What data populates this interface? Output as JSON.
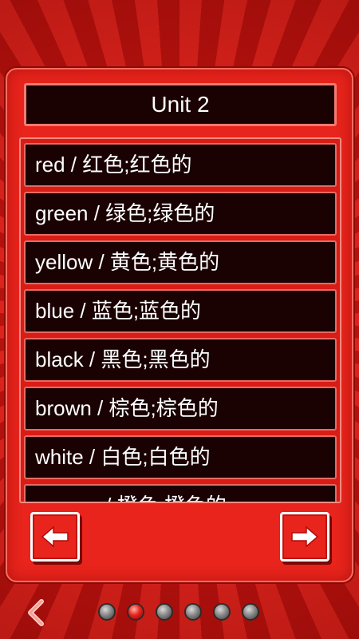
{
  "header": {
    "title": "Unit 2"
  },
  "vocabulary": {
    "items": [
      {
        "label": "red / 红色;红色的"
      },
      {
        "label": "green / 绿色;绿色的"
      },
      {
        "label": "yellow / 黄色;黄色的"
      },
      {
        "label": "blue / 蓝色;蓝色的"
      },
      {
        "label": "black / 黑色;黑色的"
      },
      {
        "label": "brown / 棕色;棕色的"
      },
      {
        "label": "white / 白色;白色的"
      },
      {
        "label": "orange / 橙色;橙色的"
      }
    ]
  },
  "navigation": {
    "prev_icon": "arrow-left-icon",
    "next_icon": "arrow-right-icon",
    "back_icon": "chevron-left-icon"
  },
  "pager": {
    "total": 6,
    "active_index": 2
  },
  "colors": {
    "accent": "#e8241c",
    "item_background": "#1a0203",
    "text": "#ffffff"
  }
}
